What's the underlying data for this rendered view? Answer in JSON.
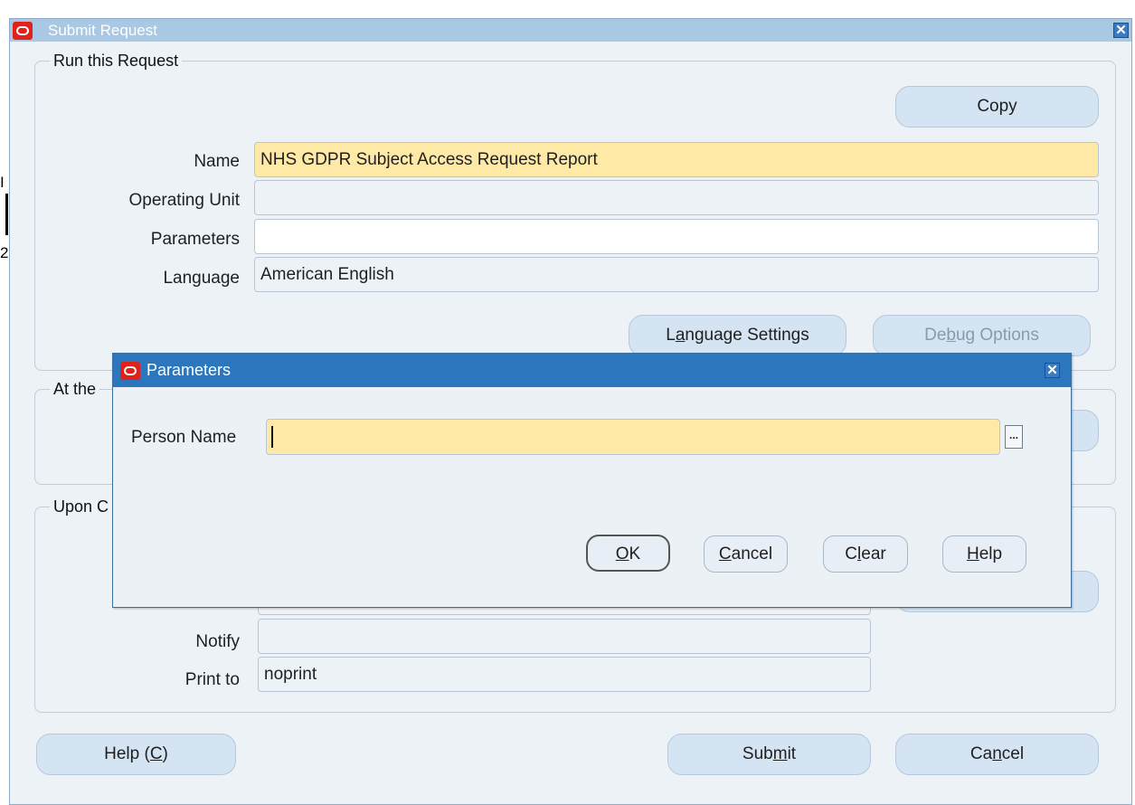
{
  "background_fragments": [
    "I",
    "2"
  ],
  "window": {
    "title": "Submit Request",
    "groups": {
      "run": "Run this Request",
      "at_the": "At the",
      "upon": "Upon C"
    },
    "copy_label": "Copy",
    "fields": {
      "name": {
        "label": "Name",
        "value": "NHS GDPR Subject Access Request Report"
      },
      "operating_unit": {
        "label": "Operating Unit",
        "value": ""
      },
      "parameters": {
        "label": "Parameters",
        "value": ""
      },
      "language": {
        "label": "Language",
        "value": "American English"
      },
      "notify": {
        "label": "Notify",
        "value": ""
      },
      "print_to": {
        "label": "Print to",
        "value": "noprint"
      }
    },
    "language_settings": {
      "pre": "L",
      "mnemonic": "a",
      "post": "nguage Settings"
    },
    "debug_options": {
      "pre": "De",
      "mnemonic": "b",
      "post": "ug Options"
    },
    "help": {
      "pre": "Help (",
      "mnemonic": "C",
      "post": ")"
    },
    "submit": {
      "pre": "Sub",
      "mnemonic": "m",
      "post": "it"
    },
    "cancel": {
      "pre": "Ca",
      "mnemonic": "n",
      "post": "cel"
    }
  },
  "dialog": {
    "title": "Parameters",
    "person_name_label": "Person Name",
    "person_name_value": "",
    "lov_label": "...",
    "ok": {
      "pre": "",
      "mnemonic": "O",
      "post": "K"
    },
    "cancel": {
      "pre": "",
      "mnemonic": "C",
      "post": "ancel"
    },
    "clear": {
      "pre": "C",
      "mnemonic": "l",
      "post": "ear"
    },
    "help": {
      "pre": "",
      "mnemonic": "H",
      "post": "elp"
    }
  },
  "colors": {
    "window_bg": "#edf2f7",
    "title_bar": "#a9c8e3",
    "dialog_title_bar": "#2b76bd",
    "required_field": "#feeaa6",
    "button": "#d4e4f3",
    "oracle_red": "#e0221a"
  },
  "icons": {
    "window_logo": "oracle-logo-icon",
    "close": "close-icon",
    "lov": "list-of-values-icon"
  }
}
